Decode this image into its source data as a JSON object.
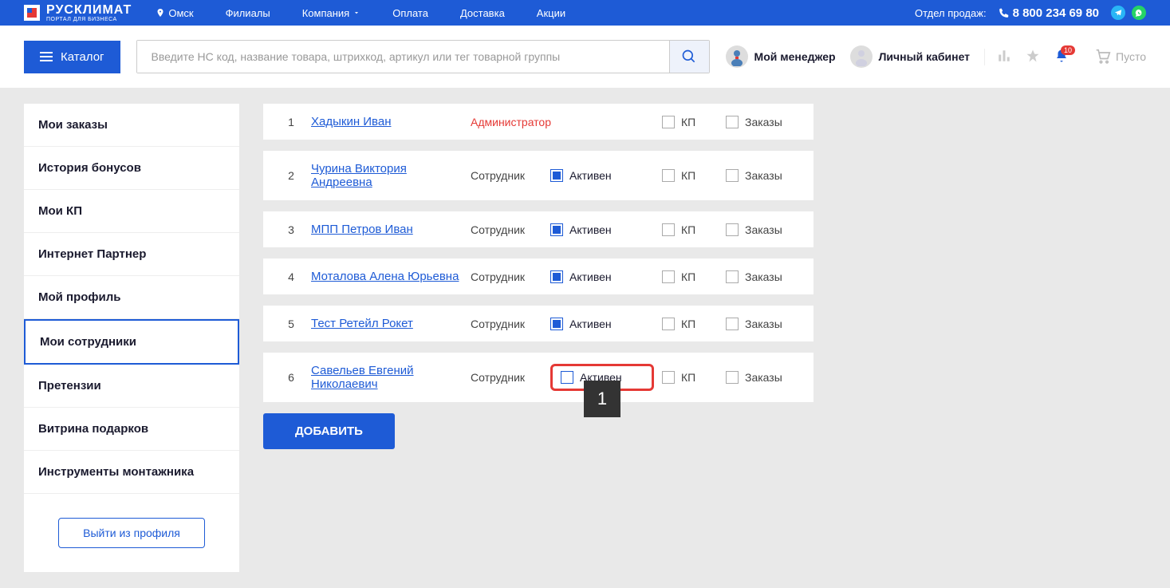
{
  "logo": {
    "main": "РУСКЛИМАТ",
    "sub": "ПОРТАЛ ДЛЯ БИЗНЕСА"
  },
  "topNav": {
    "city": "Омск",
    "branches": "Филиалы",
    "company": "Компания",
    "payment": "Оплата",
    "delivery": "Доставка",
    "promo": "Акции"
  },
  "contact": {
    "label": "Отдел продаж:",
    "phone": "8 800 234 69 80"
  },
  "catalog": "Каталог",
  "search": {
    "placeholder": "Введите НС код, название товара, штрихкод, артикул или тег товарной группы"
  },
  "header": {
    "manager": "Мой менеджер",
    "account": "Личный кабинет",
    "notifCount": "10",
    "cartEmpty": "Пусто"
  },
  "sidebar": {
    "items": [
      {
        "label": "Мои заказы",
        "active": false
      },
      {
        "label": "История бонусов",
        "active": false
      },
      {
        "label": "Мои КП",
        "active": false
      },
      {
        "label": "Интернет Партнер",
        "active": false
      },
      {
        "label": "Мой профиль",
        "active": false
      },
      {
        "label": "Мои сотрудники",
        "active": true
      },
      {
        "label": "Претензии",
        "active": false
      },
      {
        "label": "Витрина подарков",
        "active": false
      },
      {
        "label": "Инструменты монтажника",
        "active": false
      }
    ],
    "logout": "Выйти из профиля"
  },
  "roles": {
    "admin": "Администратор",
    "employee": "Сотрудник"
  },
  "statusLabel": "Активен",
  "kpLabel": "КП",
  "ordersLabel": "Заказы",
  "employees": [
    {
      "num": "1",
      "name": "Хадыкин Иван",
      "role": "admin",
      "showStatus": false,
      "active": false,
      "highlighted": false
    },
    {
      "num": "2",
      "name": "Чурина Виктория Андреевна",
      "role": "employee",
      "showStatus": true,
      "active": true,
      "highlighted": false
    },
    {
      "num": "3",
      "name": "МПП Петров Иван",
      "role": "employee",
      "showStatus": true,
      "active": true,
      "highlighted": false
    },
    {
      "num": "4",
      "name": "Моталова Алена Юрьевна",
      "role": "employee",
      "showStatus": true,
      "active": true,
      "highlighted": false
    },
    {
      "num": "5",
      "name": "Тест Ретейл Рокет",
      "role": "employee",
      "showStatus": true,
      "active": true,
      "highlighted": false
    },
    {
      "num": "6",
      "name": "Савельев Евгений Николаевич",
      "role": "employee",
      "showStatus": true,
      "active": false,
      "highlighted": true
    }
  ],
  "highlightNumber": "1",
  "addButton": "ДОБАВИТЬ"
}
